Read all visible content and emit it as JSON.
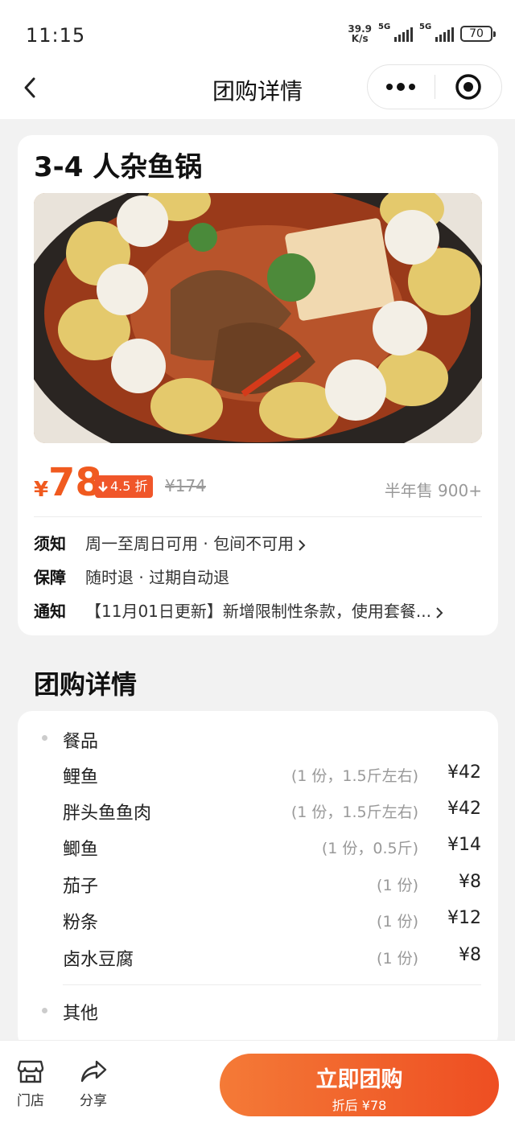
{
  "status": {
    "time": "11:15",
    "speed_value": "39.9",
    "speed_unit": "K/s",
    "sim1": "5G",
    "sim2": "5G",
    "battery": "70"
  },
  "nav": {
    "title": "团购详情",
    "icons": [
      "back-arrow-icon",
      "more-dots-icon",
      "target-close-icon"
    ]
  },
  "deal": {
    "title": "3-4 人杂鱼锅",
    "currency": "¥",
    "price": "78",
    "discount": "4.5 折",
    "original_price": "¥174",
    "sold": "半年售 900+",
    "info": [
      {
        "label": "须知",
        "text": "周一至周日可用 · 包间不可用"
      },
      {
        "label": "保障",
        "text": "随时退 · 过期自动退"
      },
      {
        "label": "通知",
        "text": "【11月01日更新】新增限制性条款，使用套餐..."
      }
    ]
  },
  "details": {
    "section_title": "团购详情",
    "group_food": "餐品",
    "items": [
      {
        "name": "鲤鱼",
        "qty": "(1 份，1.5斤左右)",
        "price": "¥42"
      },
      {
        "name": "胖头鱼鱼肉",
        "qty": "(1 份，1.5斤左右)",
        "price": "¥42"
      },
      {
        "name": "鲫鱼",
        "qty": "(1 份，0.5斤)",
        "price": "¥14"
      },
      {
        "name": "茄子",
        "qty": "(1 份)",
        "price": "¥8"
      },
      {
        "name": "粉条",
        "qty": "(1 份)",
        "price": "¥12"
      },
      {
        "name": "卤水豆腐",
        "qty": "(1 份)",
        "price": "¥8"
      }
    ],
    "group_other": "其他"
  },
  "bottom": {
    "store_label": "门店",
    "share_label": "分享",
    "buy_label": "立即团购",
    "buy_sub": "折后 ¥78"
  },
  "colors": {
    "accent": "#f05a1f",
    "button_start": "#f47a37",
    "button_end": "#ee4e22"
  }
}
